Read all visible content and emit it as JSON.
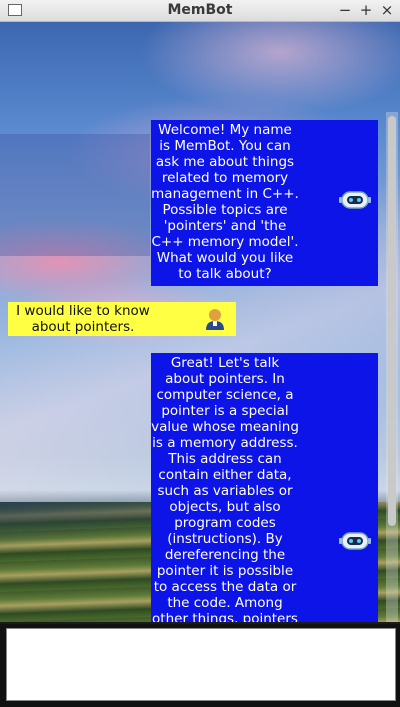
{
  "window": {
    "title": "MemBot",
    "minimize_label": "−",
    "maximize_label": "+",
    "close_label": "×"
  },
  "chat": {
    "messages": [
      {
        "sender": "bot",
        "icon": "robot-icon",
        "text": "Welcome! My name is MemBot. You can ask me about things related to memory management in C++. Possible topics are 'pointers' and 'the C++ memory model'. What would you like to talk about?"
      },
      {
        "sender": "user",
        "icon": "user-icon",
        "text": "I would like to know about pointers."
      },
      {
        "sender": "bot",
        "icon": "robot-icon",
        "text": "Great! Let's talk about pointers. In computer science, a pointer is a special value whose meaning is a memory address. This address can contain either data, such as variables or objects, but also program codes (instructions). By dereferencing the pointer it is possible to access the data or the code. Among other things, pointers"
      }
    ]
  },
  "input": {
    "value": ""
  },
  "colors": {
    "bot_bubble": "#0d14e8",
    "user_bubble": "#ffff44"
  }
}
